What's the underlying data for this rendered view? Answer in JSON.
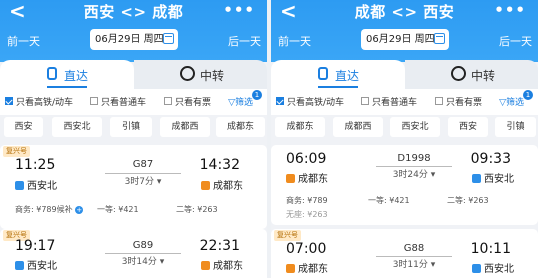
{
  "left": {
    "header": {
      "back": "<",
      "title": "西安 <> 成都",
      "more": "•••",
      "prev_day": "前一天",
      "date": "06月29日 周四",
      "next_day": "后一天"
    },
    "tabs": [
      "直达",
      "中转"
    ],
    "filters": {
      "high_speed": "只看高铁/动车",
      "normal": "只看普通车",
      "has_ticket": "只看有票",
      "filter": "筛选",
      "badge": "1"
    },
    "stations": [
      "西安",
      "西安北",
      "引镇",
      "成都西",
      "成都东"
    ],
    "trains": [
      {
        "tag": "复兴号",
        "dep": "11:25",
        "no": "G87",
        "dur": "3时7分",
        "arr": "14:32",
        "from": "西安北",
        "to": "成都东",
        "s1": "商务: ¥789候补",
        "s2": "一等: ¥421",
        "s3": "二等: ¥263"
      },
      {
        "tag": "复兴号",
        "dep": "19:17",
        "no": "G89",
        "dur": "3时14分",
        "arr": "22:31",
        "from": "西安北",
        "to": "成都东"
      }
    ]
  },
  "right": {
    "header": {
      "back": "<",
      "title": "成都 <> 西安",
      "more": "•••",
      "prev_day": "前一天",
      "date": "06月29日 周四",
      "next_day": "后一天"
    },
    "tabs": [
      "直达",
      "中转"
    ],
    "filters": {
      "high_speed": "只看高铁/动车",
      "normal": "只看普通车",
      "has_ticket": "只看有票",
      "filter": "筛选",
      "badge": "1"
    },
    "stations": [
      "成都东",
      "成都西",
      "西安北",
      "西安",
      "引镇"
    ],
    "trains": [
      {
        "dep": "06:09",
        "no": "D1998",
        "dur": "3时24分",
        "arr": "09:33",
        "from": "成都东",
        "to": "西安北",
        "s1": "商务: ¥789",
        "s2": "一等: ¥421",
        "s3": "二等: ¥263",
        "s4": "无座: ¥263"
      },
      {
        "tag": "复兴号",
        "dep": "07:00",
        "no": "G88",
        "dur": "3时11分",
        "arr": "10:11",
        "from": "成都东",
        "to": "西安北"
      }
    ]
  }
}
